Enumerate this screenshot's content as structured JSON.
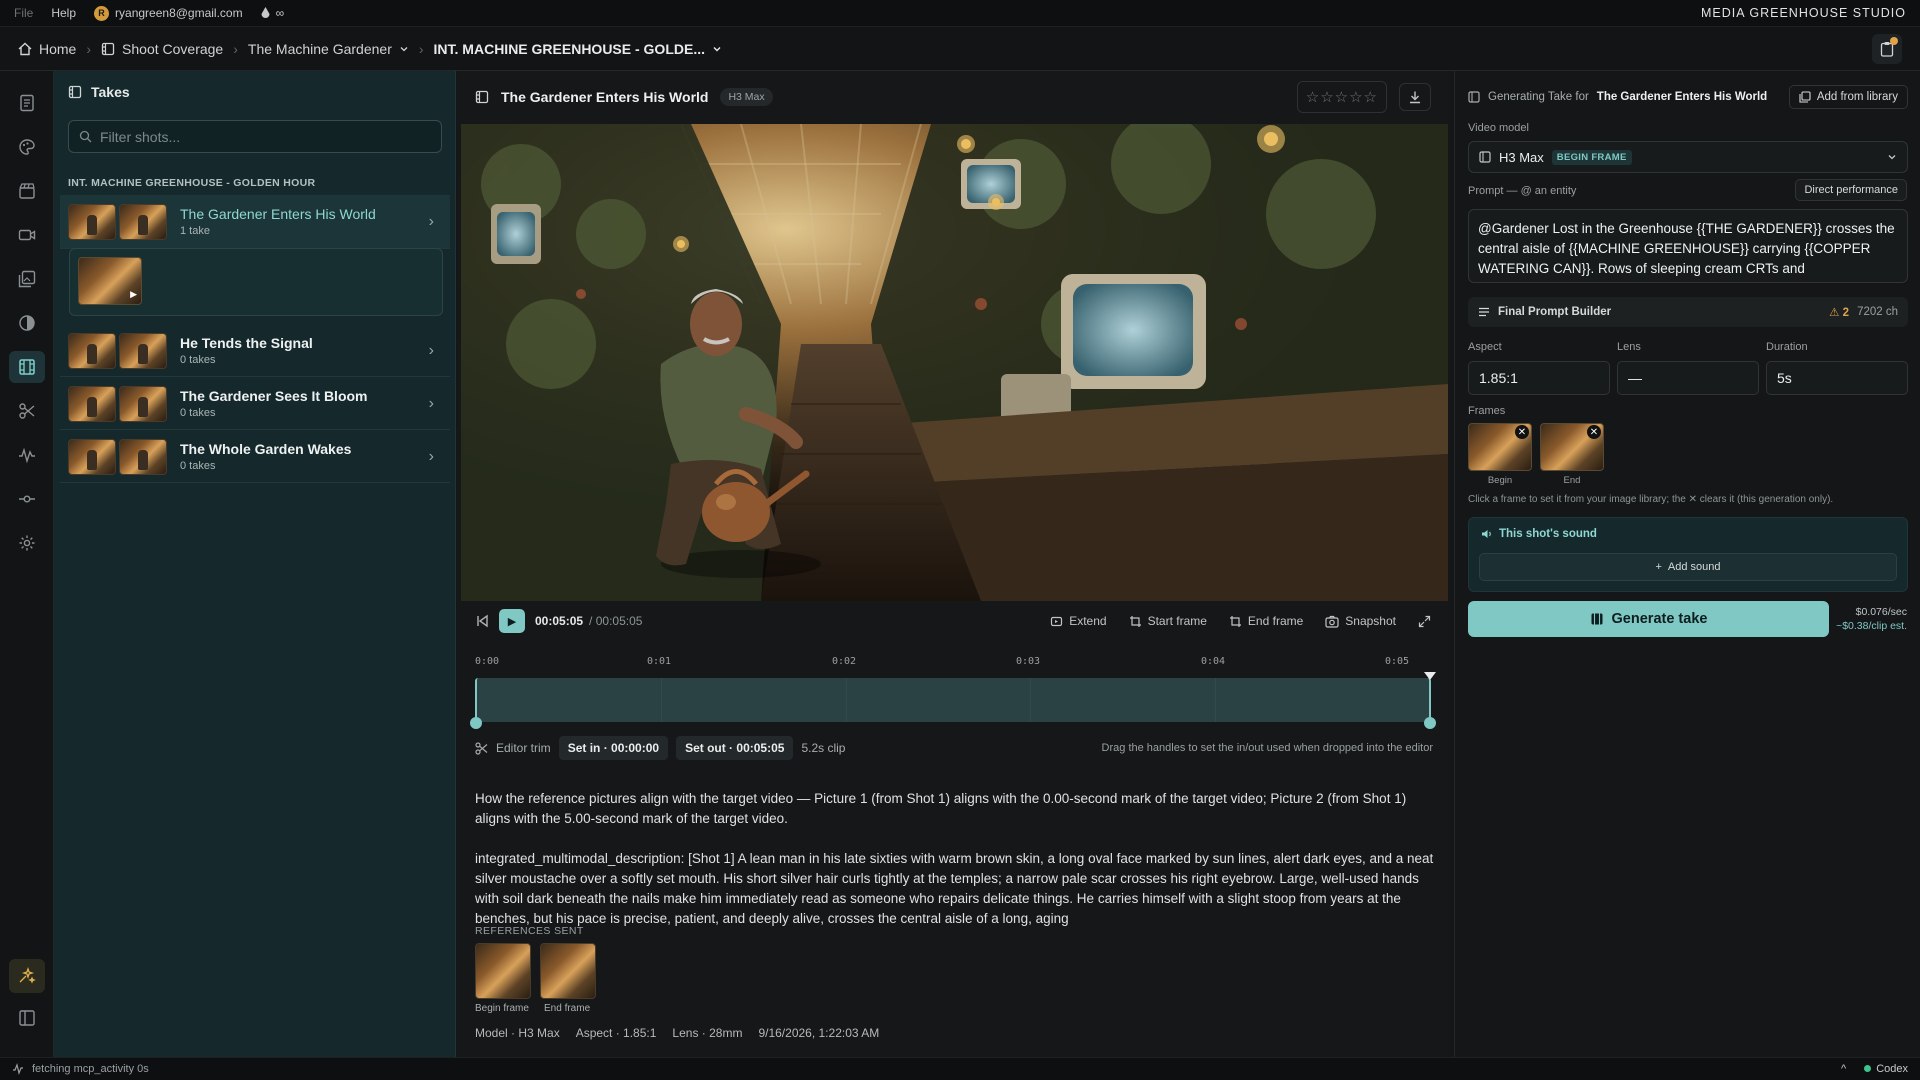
{
  "menubar": {
    "file": "File",
    "help": "Help",
    "account_initial": "R",
    "account_email": "ryangreen8@gmail.com",
    "credits": "∞",
    "brand": "MEDIA GREENHOUSE STUDIO"
  },
  "breadcrumb": {
    "home": "Home",
    "section": "Shoot Coverage",
    "project": "The Machine Gardener",
    "scene": "INT. MACHINE GREENHOUSE - GOLDE..."
  },
  "takes": {
    "title": "Takes",
    "filter_placeholder": "Filter shots...",
    "group": "INT. MACHINE GREENHOUSE - GOLDEN HOUR",
    "shots": [
      {
        "title": "The Gardener Enters His World",
        "sub": "1 take"
      },
      {
        "title": "He Tends the Signal",
        "sub": "0 takes"
      },
      {
        "title": "The Gardener Sees It Bloom",
        "sub": "0 takes"
      },
      {
        "title": "The Whole Garden Wakes",
        "sub": "0 takes"
      }
    ]
  },
  "viewer": {
    "title": "The Gardener Enters His World",
    "model_pill": "H3 Max",
    "stars": "☆☆☆☆☆",
    "time_current": "00:05:05",
    "time_total": "/ 00:05:05",
    "tools": {
      "extend": "Extend",
      "start": "Start frame",
      "end": "End frame",
      "snapshot": "Snapshot"
    },
    "ruler": [
      "0:00",
      "0:01",
      "0:02",
      "0:03",
      "0:04",
      "0:05"
    ],
    "trim": {
      "label": "Editor trim",
      "set_in": "Set in · 00:00:00",
      "set_out": "Set out · 00:05:05",
      "clip": "5.2s clip",
      "hint": "Drag the handles to set the in/out used when dropped into the editor"
    },
    "align_text": "How the reference pictures align with the target video — Picture 1 (from Shot 1) aligns with the 0.00-second mark of the target video; Picture 2 (from Shot 1) aligns with the 5.00-second mark of the target video.",
    "description": "integrated_multimodal_description: [Shot 1] A lean man in his late sixties with warm brown skin, a long oval face marked by sun lines, alert dark eyes, and a neat silver moustache over a softly set mouth. His short silver hair curls tightly at the temples; a narrow pale scar crosses his right eyebrow. Large, well-used hands with soil dark beneath the nails make him immediately read as someone who repairs delicate things. He carries himself with a slight stoop from years at the benches, but his pace is precise, patient, and deeply alive, crosses the central aisle of a long, aging",
    "refs_label": "REFERENCES SENT",
    "ref_begin": "Begin frame",
    "ref_end": "End frame",
    "meta": {
      "model": "Model · H3 Max",
      "aspect": "Aspect · 1.85:1",
      "lens": "Lens · 28mm",
      "date": "9/16/2026, 1:22:03 AM"
    }
  },
  "right": {
    "generating_prefix": "Generating Take for",
    "generating_shot": "The Gardener Enters His World",
    "add_library": "Add from library",
    "video_model_label": "Video model",
    "video_model": "H3 Max",
    "begin_badge": "BEGIN FRAME",
    "prompt_label": "Prompt — @ an entity",
    "direct_btn": "Direct performance",
    "prompt": "@Gardener Lost in the Greenhouse {{THE GARDENER}} crosses the central aisle of {{MACHINE GREENHOUSE}} carrying {{COPPER WATERING CAN}}. Rows of sleeping cream CRTs and",
    "fpb_label": "Final Prompt Builder",
    "fpb_warn": "⚠ 2",
    "fpb_chars": "7202 ch",
    "aspect_label": "Aspect",
    "aspect": "1.85:1",
    "lens_label": "Lens",
    "lens": "—",
    "duration_label": "Duration",
    "duration": "5s",
    "frames_label": "Frames",
    "frame_begin": "Begin",
    "frame_end": "End",
    "frames_hint": "Click a frame to set it from your image library; the ✕ clears it (this generation only).",
    "sound_title": "This shot's sound",
    "add_sound": "Add sound",
    "generate": "Generate take",
    "cost_rate": "$0.076/sec",
    "cost_est": "~$0.38/clip est."
  },
  "status": {
    "left": "fetching mcp_activity 0s",
    "right": "Codex"
  },
  "colors": {
    "accent": "#7fc8c4",
    "panel": "#15292c",
    "warning": "#e0a34a"
  }
}
